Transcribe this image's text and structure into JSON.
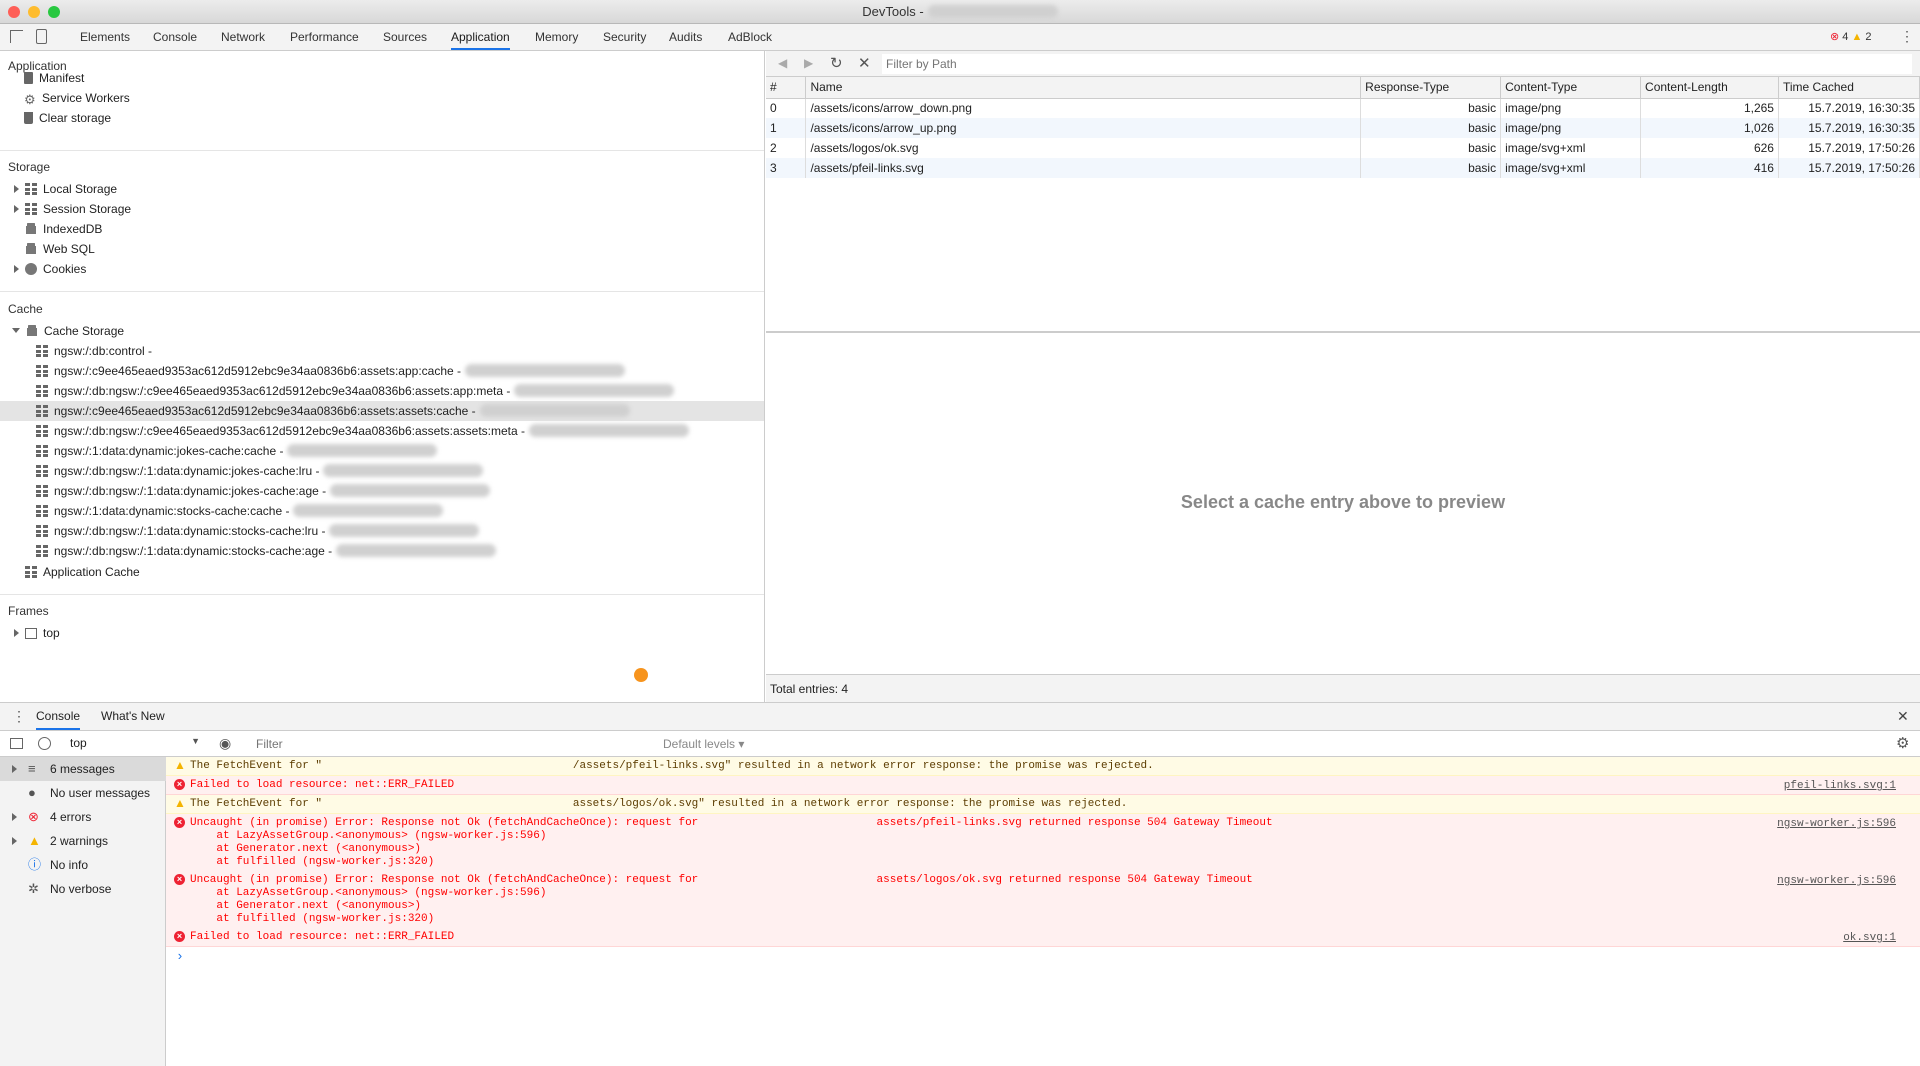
{
  "window": {
    "title": "DevTools -"
  },
  "panel_tabs": [
    "Elements",
    "Console",
    "Network",
    "Performance",
    "Sources",
    "Application",
    "Memory",
    "Security",
    "Audits",
    "AdBlock"
  ],
  "active_tab": "Application",
  "badges": {
    "errors": "4",
    "warnings": "2"
  },
  "sidebar": {
    "application_header": "Application",
    "application_items": [
      "Manifest",
      "Service Workers",
      "Clear storage"
    ],
    "storage_header": "Storage",
    "storage_items": [
      "Local Storage",
      "Session Storage",
      "IndexedDB",
      "Web SQL",
      "Cookies"
    ],
    "cache_header": "Cache",
    "cache_storage_label": "Cache Storage",
    "caches": [
      "ngsw:/:db:control -",
      "ngsw:/:c9ee465eaed9353ac612d5912ebc9e34aa0836b6:assets:app:cache -",
      "ngsw:/:db:ngsw:/:c9ee465eaed9353ac612d5912ebc9e34aa0836b6:assets:app:meta -",
      "ngsw:/:c9ee465eaed9353ac612d5912ebc9e34aa0836b6:assets:assets:cache -",
      "ngsw:/:db:ngsw:/:c9ee465eaed9353ac612d5912ebc9e34aa0836b6:assets:assets:meta -",
      "ngsw:/:1:data:dynamic:jokes-cache:cache -",
      "ngsw:/:db:ngsw:/:1:data:dynamic:jokes-cache:lru -",
      "ngsw:/:db:ngsw:/:1:data:dynamic:jokes-cache:age -",
      "ngsw:/:1:data:dynamic:stocks-cache:cache -",
      "ngsw:/:db:ngsw:/:1:data:dynamic:stocks-cache:lru -",
      "ngsw:/:db:ngsw:/:1:data:dynamic:stocks-cache:age -"
    ],
    "application_cache_label": "Application Cache",
    "frames_header": "Frames",
    "frames_top": "top"
  },
  "cache_table": {
    "filter_placeholder": "Filter by Path",
    "columns": [
      "#",
      "Name",
      "Response-Type",
      "Content-Type",
      "Content-Length",
      "Time Cached"
    ],
    "rows": [
      [
        "0",
        "/assets/icons/arrow_down.png",
        "basic",
        "image/png",
        "1,265",
        "15.7.2019, 16:30:35"
      ],
      [
        "1",
        "/assets/icons/arrow_up.png",
        "basic",
        "image/png",
        "1,026",
        "15.7.2019, 16:30:35"
      ],
      [
        "2",
        "/assets/logos/ok.svg",
        "basic",
        "image/svg+xml",
        "626",
        "15.7.2019, 17:50:26"
      ],
      [
        "3",
        "/assets/pfeil-links.svg",
        "basic",
        "image/svg+xml",
        "416",
        "15.7.2019, 17:50:26"
      ]
    ],
    "preview_text": "Select a cache entry above to preview",
    "total": "Total entries: 4"
  },
  "drawer": {
    "tabs": [
      "Console",
      "What's New"
    ],
    "context": "top",
    "filter_placeholder": "Filter",
    "levels": "Default levels ▾",
    "sidebar": [
      "6 messages",
      "No user messages",
      "4 errors",
      "2 warnings",
      "No info",
      "No verbose"
    ],
    "messages": [
      {
        "type": "warn",
        "text": "The FetchEvent for \"                                      /assets/pfeil-links.svg\" resulted in a network error response: the promise was rejected.",
        "src": ""
      },
      {
        "type": "err",
        "text": "Failed to load resource: net::ERR_FAILED",
        "src": "pfeil-links.svg:1"
      },
      {
        "type": "warn",
        "text": "The FetchEvent for \"                                      assets/logos/ok.svg\" resulted in a network error response: the promise was rejected.",
        "src": ""
      },
      {
        "type": "err",
        "text": "Uncaught (in promise) Error: Response not Ok (fetchAndCacheOnce): request for                           assets/pfeil-links.svg returned response 504 Gateway Timeout\n    at LazyAssetGroup.<anonymous> (ngsw-worker.js:596)\n    at Generator.next (<anonymous>)\n    at fulfilled (ngsw-worker.js:320)",
        "src": "ngsw-worker.js:596"
      },
      {
        "type": "err",
        "text": "Uncaught (in promise) Error: Response not Ok (fetchAndCacheOnce): request for                           assets/logos/ok.svg returned response 504 Gateway Timeout\n    at LazyAssetGroup.<anonymous> (ngsw-worker.js:596)\n    at Generator.next (<anonymous>)\n    at fulfilled (ngsw-worker.js:320)",
        "src": "ngsw-worker.js:596"
      },
      {
        "type": "err",
        "text": "Failed to load resource: net::ERR_FAILED",
        "src": "ok.svg:1"
      }
    ],
    "prompt": "›"
  }
}
